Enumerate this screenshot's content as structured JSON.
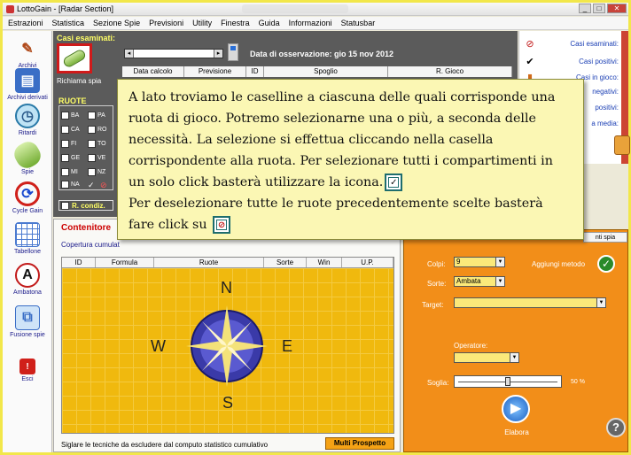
{
  "window": {
    "title": "LottoGain - [Radar Section]"
  },
  "menu": [
    "Estrazioni",
    "Statistica",
    "Sezione Spie",
    "Previsioni",
    "Utility",
    "Finestra",
    "Guida",
    "Informazioni",
    "Statusbar"
  ],
  "sidebar": {
    "items": [
      {
        "label": "Archivi",
        "icon": "pen-icon"
      },
      {
        "label": "Archivi derivati",
        "icon": "archive-icon"
      },
      {
        "label": "Ritardi",
        "icon": "clock-icon"
      },
      {
        "label": "Spie",
        "icon": "spy-icon"
      },
      {
        "label": "Cycle Gain",
        "icon": "cycle-icon"
      },
      {
        "label": "Tabellone",
        "icon": "table-icon"
      },
      {
        "label": "Ambatona",
        "icon": "letter-a-icon"
      },
      {
        "label": "Fusione spie",
        "icon": "merge-icon"
      },
      {
        "label": "Esci",
        "icon": "exit-icon"
      }
    ]
  },
  "left_panel": {
    "title": "Casi esaminati:",
    "richiama": "Richiama spia",
    "ruote_title": "RUOTE",
    "wheels": [
      "BA",
      "FI",
      "CA",
      "GE",
      "MI",
      "NA",
      "PA",
      "RO",
      "TO",
      "VE",
      "NZ"
    ],
    "rcond": "R. condiz."
  },
  "top_panel": {
    "data_osservazione": "Data di osservazione:  gio 15 nov 2012",
    "columns": [
      "Data calcolo",
      "Previsione",
      "ID",
      "Spoglio",
      "R. Gioco"
    ]
  },
  "right_panel": {
    "items": [
      {
        "label": "Casi esaminati:",
        "icon": "forbidden-icon"
      },
      {
        "label": "Casi positivi:",
        "icon": "check-icon"
      },
      {
        "label": "Casi in gioco:",
        "icon": "jar-icon"
      },
      {
        "label": "negativi:",
        "icon": ""
      },
      {
        "label": "positivi:",
        "icon": ""
      },
      {
        "label": "a media:",
        "icon": ""
      }
    ]
  },
  "contenitore": {
    "title": "Contenitore",
    "copertura": "Copertura cumulat",
    "columns": [
      "ID",
      "Formula",
      "Ruote",
      "Sorte",
      "Win",
      "U.P."
    ],
    "compass": {
      "n": "N",
      "s": "S",
      "e": "E",
      "w": "W"
    },
    "footer": "Siglare le tecniche da escludere dal computo statistico cumulativo",
    "multi_prospetto": "Multi Prospetto"
  },
  "right_bottom": {
    "tab": "nti spia",
    "colpi_label": "Colpi:",
    "colpi_value": "9",
    "aggiungi": "Aggiungi metodo",
    "sorte_label": "Sorte:",
    "sorte_value": "Ambata",
    "target_label": "Target:",
    "operatore_label": "Operatore:",
    "soglia_label": "Soglia:",
    "soglia_percent": 50,
    "soglia_value": "50 %",
    "elabora": "Elabora"
  },
  "tooltip": {
    "line1": "A lato troviamo le caselline a ciascuna delle quali corrisponde una ruota di gioco. Potremo selezionarne una o più, a seconda delle necessità. La selezione si effettua cliccando nella casella corrispondente alla ruota. Per selezionare tutti i compartimenti in un solo click basterà utilizzare la icona.",
    "line2": "Per deselezionare tutte le ruote precedentemente scelte basterà fare click su"
  },
  "colors": {
    "accent_yellow": "#ffff66",
    "panel_gray": "#5b5b5b",
    "orange": "#f28e19",
    "grid_yellow": "#f0b90e"
  }
}
